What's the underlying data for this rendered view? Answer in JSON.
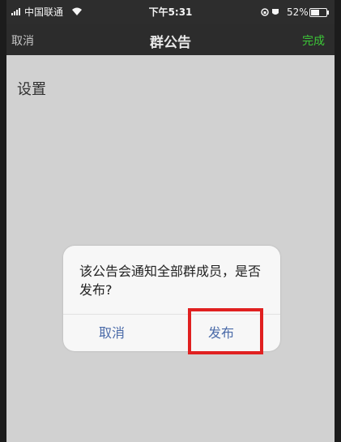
{
  "status_bar": {
    "carrier": "中国联通",
    "time": "下午5:31",
    "battery": "52%",
    "battery_level": 0.52
  },
  "nav": {
    "cancel": "取消",
    "title": "群公告",
    "done": "完成"
  },
  "content": {
    "text": "设置"
  },
  "dialog": {
    "message": "该公告会通知全部群成员，是否发布?",
    "cancel": "取消",
    "publish": "发布"
  },
  "colors": {
    "done": "#3fd13a",
    "button": "#4a6aa8",
    "highlight": "#e02020"
  }
}
